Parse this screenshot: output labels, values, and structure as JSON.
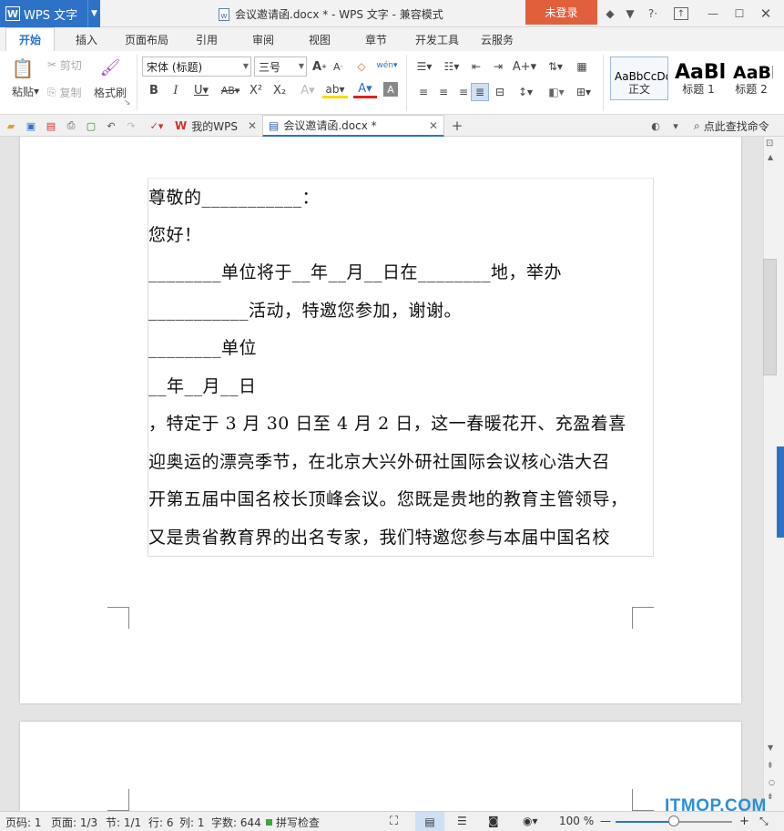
{
  "app": {
    "name": "WPS 文字",
    "logo": "W"
  },
  "window": {
    "title": "会议邀请函.docx * - WPS 文字 - 兼容模式",
    "login_label": "未登录"
  },
  "menu_tabs": [
    "开始",
    "插入",
    "页面布局",
    "引用",
    "审阅",
    "视图",
    "章节",
    "开发工具",
    "云服务"
  ],
  "active_tab": "开始",
  "ribbon": {
    "paste": "粘贴",
    "cut": "剪切",
    "copy": "复制",
    "format_painter": "格式刷",
    "font_name": "宋体 (标题)",
    "font_size": "三号",
    "styles": [
      {
        "sample": "AaBbCcDd",
        "label": "正文"
      },
      {
        "sample": "AaBl",
        "label": "标题 1"
      },
      {
        "sample": "AaBl",
        "label": "标题 2"
      }
    ],
    "accent_color": "#2e72c8",
    "highlight_color": "#ffd800",
    "font_color": "#e02020"
  },
  "doc_tabs": [
    {
      "label": "我的WPS"
    },
    {
      "label": "会议邀请函.docx *"
    }
  ],
  "find_command": "点此查找命令",
  "document": {
    "lines": [
      "  尊敬的___________：",
      " 您好！",
      " ________单位将于__年__月__日在________地，举办",
      "___________活动，特邀您参加，谢谢。",
      "  ________单位",
      "__年__月__日",
      "，特定于 3 月 30 日至 4 月 2 日，这一春暖花开、充盈着喜",
      "迎奥运的漂亮季节，在北京大兴外研社国际会议核心浩大召",
      "开第五届中国名校长顶峰会议。您既是贵地的教育主管领导，",
      "又是贵省教育界的出名专家，我们特邀您参与本届中国名校"
    ]
  },
  "status": {
    "page_num": "页码: 1",
    "pages": "页面: 1/3",
    "section": "节: 1/1",
    "row": "行: 6",
    "col": "列: 1",
    "word_count": "字数: 644",
    "spell_check": "拼写检查",
    "zoom": "100 %",
    "zoom_level": 0.5
  },
  "watermark": "ITMOP.COM"
}
